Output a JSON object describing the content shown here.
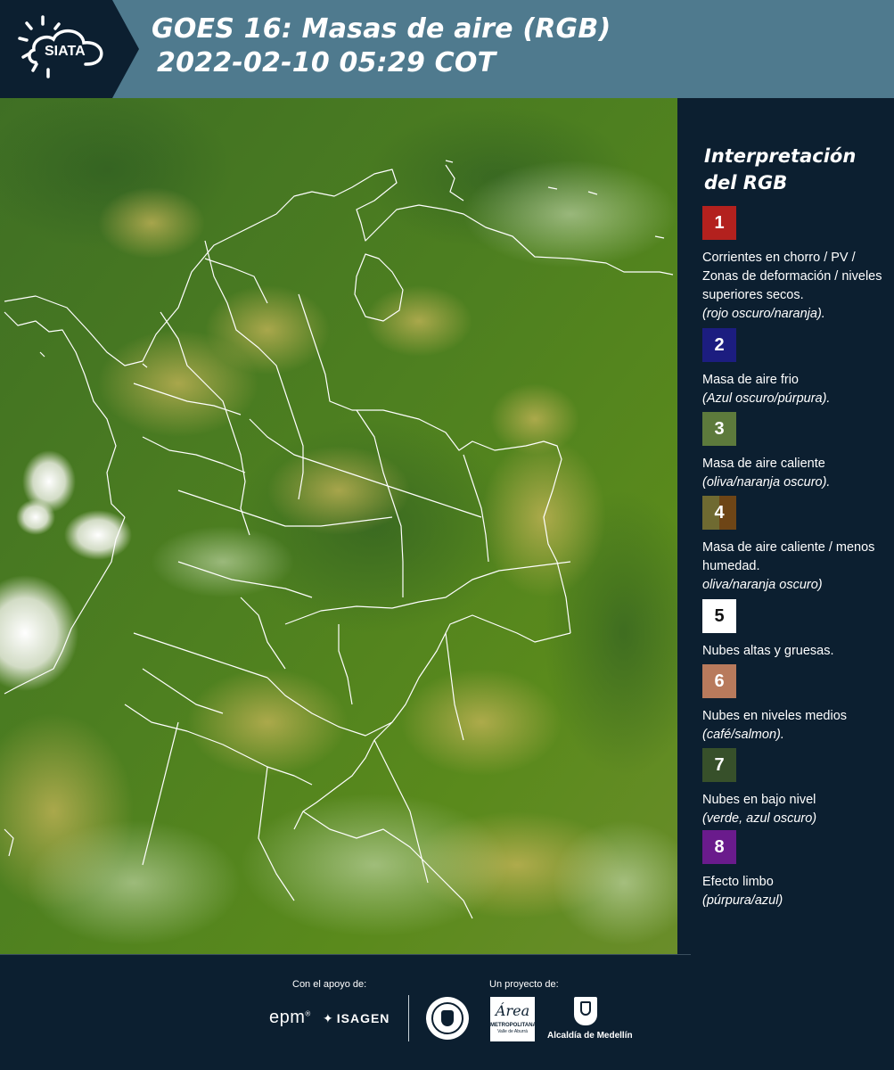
{
  "header": {
    "logo_text": "SIATA",
    "title_line1": "GOES 16: Masas de aire (RGB)",
    "title_line2": "2022-02-10 05:29 COT",
    "colors": {
      "header_bg": "#4f7a8e",
      "logo_bg": "#0c1f30"
    }
  },
  "legend": {
    "title": "Interpretación del RGB",
    "items": [
      {
        "number": "1",
        "color": "#b3211e",
        "desc": "Corrientes en chorro / PV / Zonas de deformación / niveles superiores secos.",
        "note": "(rojo oscuro/naranja)."
      },
      {
        "number": "2",
        "color": "#1c1d80",
        "desc": "Masa de aire frio",
        "note": "(Azul oscuro/púrpura)."
      },
      {
        "number": "3",
        "color": "#5d7a3c",
        "desc": "Masa de aire caliente",
        "note": "(oliva/naranja oscuro)."
      },
      {
        "number": "4",
        "color_left": "#6f6a31",
        "color_right": "#6e4516",
        "desc": "Masa de aire caliente / menos humedad.",
        "note": "oliva/naranja oscuro)"
      },
      {
        "number": "5",
        "color": "#ffffff",
        "desc": "Nubes altas y gruesas.",
        "note": ""
      },
      {
        "number": "6",
        "color": "#b87a5c",
        "desc": "Nubes en niveles medios",
        "note": "(café/salmon)."
      },
      {
        "number": "7",
        "color": "#37502a",
        "desc": "Nubes en bajo nivel",
        "note": "(verde, azul oscuro)"
      },
      {
        "number": "8",
        "color": "#6a1b8c",
        "desc": "Efecto limbo",
        "note": "(púrpura/azul)"
      }
    ]
  },
  "footer": {
    "support_label": "Con el apoyo de:",
    "project_label": "Un proyecto de:",
    "brand_epm": "epm",
    "brand_isagen": "ISAGEN",
    "brand_area": "Área",
    "brand_area_sub": "METROPOLITANA",
    "brand_area_sub2": "Valle de Aburrá",
    "brand_alcaldia": "Alcaldía de Medellín"
  }
}
